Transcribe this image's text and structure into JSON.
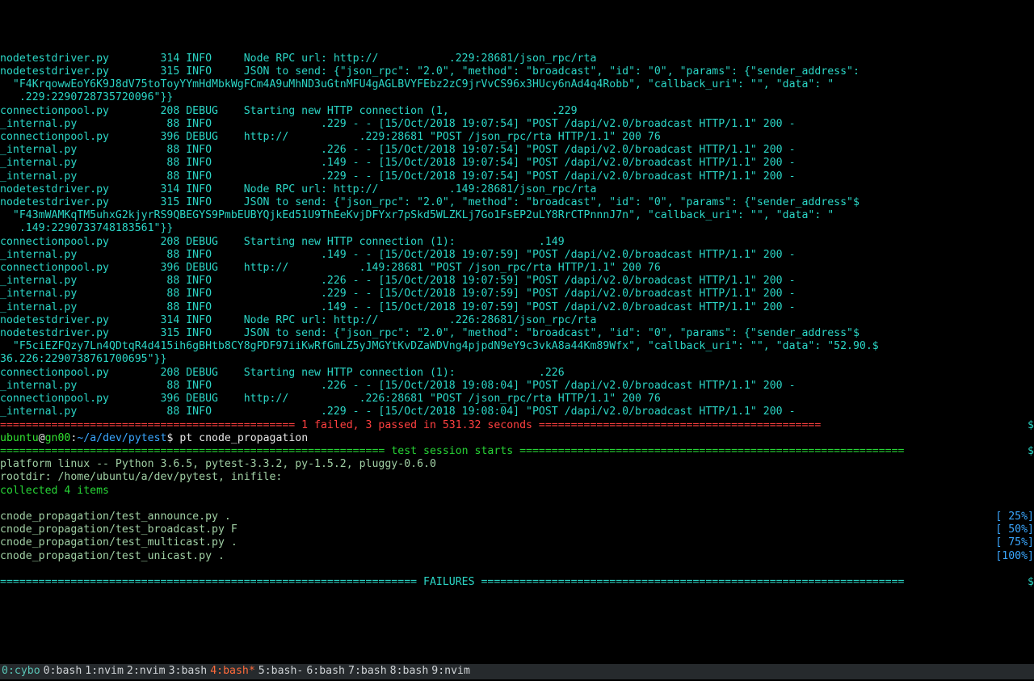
{
  "logs": [
    {
      "file": "nodetestdriver.py",
      "no": "314",
      "lvl": "INFO ",
      "msg": "Node RPC url: http://           .229:28681/json_rpc/rta"
    },
    {
      "file": "nodetestdriver.py",
      "no": "315",
      "lvl": "INFO ",
      "msg": "JSON to send: {\"json_rpc\": \"2.0\", \"method\": \"broadcast\", \"id\": \"0\", \"params\": {\"sender_address\":",
      "cont": [
        "  \"F4KrqowwEoY6K9J8dV75toToyYYmHdMbkWgFCm4A9uMhND3uGtnMFU4gAGLBVYFEbz2zC9jrVvCS96x3HUcy6nAd4q4Robb\", \"callback_uri\": \"\", \"data\": \"  ",
        "   .229:2290728735720096\"}}"
      ]
    },
    {
      "file": "connectionpool.py",
      "no": "208",
      "lvl": "DEBUG",
      "msg": "Starting new HTTP connection (1,                .229"
    },
    {
      "file": "_internal.py",
      "no": " 88",
      "lvl": "INFO ",
      "msg": "            .229 - - [15/Oct/2018 19:07:54] \"POST /dapi/v2.0/broadcast HTTP/1.1\" 200 -"
    },
    {
      "file": "connectionpool.py",
      "no": "396",
      "lvl": "DEBUG",
      "msg": "http://           .229:28681 \"POST /json_rpc/rta HTTP/1.1\" 200 76"
    },
    {
      "file": "_internal.py",
      "no": " 88",
      "lvl": "INFO ",
      "msg": "            .226 - - [15/Oct/2018 19:07:54] \"POST /dapi/v2.0/broadcast HTTP/1.1\" 200 -"
    },
    {
      "file": "_internal.py",
      "no": " 88",
      "lvl": "INFO ",
      "msg": "            .149 - - [15/Oct/2018 19:07:54] \"POST /dapi/v2.0/broadcast HTTP/1.1\" 200 -"
    },
    {
      "file": "_internal.py",
      "no": " 88",
      "lvl": "INFO ",
      "msg": "            .229 - - [15/Oct/2018 19:07:54] \"POST /dapi/v2.0/broadcast HTTP/1.1\" 200 -"
    },
    {
      "file": "nodetestdriver.py",
      "no": "314",
      "lvl": "INFO ",
      "msg": "Node RPC url: http://           .149:28681/json_rpc/rta"
    },
    {
      "file": "nodetestdriver.py",
      "no": "315",
      "lvl": "INFO ",
      "msg": "JSON to send: {\"json_rpc\": \"2.0\", \"method\": \"broadcast\", \"id\": \"0\", \"params\": {\"sender_address\"$",
      "cont": [
        "  \"F43mWAMKqTM5uhxG2kjyrRS9QBEGYS9PmbEUBYQjkEd51U9ThEeKvjDFYxr7pSkd5WLZKLj7Go1FsEP2uLY8RrCTPnnnJ7n\", \"callback_uri\": \"\", \"data\": \"",
        "   .149:2290733748183561\"}}"
      ]
    },
    {
      "file": "connectionpool.py",
      "no": "208",
      "lvl": "DEBUG",
      "msg": "Starting new HTTP connection (1):             .149"
    },
    {
      "file": "_internal.py",
      "no": " 88",
      "lvl": "INFO ",
      "msg": "            .149 - - [15/Oct/2018 19:07:59] \"POST /dapi/v2.0/broadcast HTTP/1.1\" 200 -"
    },
    {
      "file": "connectionpool.py",
      "no": "396",
      "lvl": "DEBUG",
      "msg": "http://           .149:28681 \"POST /json_rpc/rta HTTP/1.1\" 200 76"
    },
    {
      "file": "_internal.py",
      "no": " 88",
      "lvl": "INFO ",
      "msg": "            .226 - - [15/Oct/2018 19:07:59] \"POST /dapi/v2.0/broadcast HTTP/1.1\" 200 -"
    },
    {
      "file": "_internal.py",
      "no": " 88",
      "lvl": "INFO ",
      "msg": "            .229 - - [15/Oct/2018 19:07:59] \"POST /dapi/v2.0/broadcast HTTP/1.1\" 200 -"
    },
    {
      "file": "_internal.py",
      "no": " 88",
      "lvl": "INFO ",
      "msg": "            .149 - - [15/Oct/2018 19:07:59] \"POST /dapi/v2.0/broadcast HTTP/1.1\" 200 -"
    },
    {
      "file": "nodetestdriver.py",
      "no": "314",
      "lvl": "INFO ",
      "msg": "Node RPC url: http://           .226:28681/json_rpc/rta"
    },
    {
      "file": "nodetestdriver.py",
      "no": "315",
      "lvl": "INFO ",
      "msg": "JSON to send: {\"json_rpc\": \"2.0\", \"method\": \"broadcast\", \"id\": \"0\", \"params\": {\"sender_address\"$",
      "cont": [
        "  \"F5ciEZFQzy7Ln4QDtqR4d415ih6gBHtb8CY8gPDF97iiKwRfGmLZ5yJMGYtKvDZaWDVng4pjpdN9eY9c3vkA8a44Km89Wfx\", \"callback_uri\": \"\", \"data\": \"52.90.$",
        "36.226:2290738761700695\"}}"
      ]
    },
    {
      "file": "connectionpool.py",
      "no": "208",
      "lvl": "DEBUG",
      "msg": "Starting new HTTP connection (1):             .226"
    },
    {
      "file": "_internal.py",
      "no": " 88",
      "lvl": "INFO ",
      "msg": "            .226 - - [15/Oct/2018 19:08:04] \"POST /dapi/v2.0/broadcast HTTP/1.1\" 200 -"
    },
    {
      "file": "connectionpool.py",
      "no": "396",
      "lvl": "DEBUG",
      "msg": "http://           .226:28681 \"POST /json_rpc/rta HTTP/1.1\" 200 76"
    },
    {
      "file": "_internal.py",
      "no": " 88",
      "lvl": "INFO ",
      "msg": "            .229 - - [15/Oct/2018 19:08:04] \"POST /dapi/v2.0/broadcast HTTP/1.1\" 200 -"
    }
  ],
  "summary_prev": "============================================== 1 failed, 3 passed in 531.32 seconds ============================================",
  "summary_prev_trail": "$",
  "prompt": {
    "user": "ubuntu",
    "at": "@",
    "host": "gn00",
    "sep": ":",
    "path": "~/a/dev/pytest",
    "dollar": "$ ",
    "cmd": "pt cnode_propagation"
  },
  "session_header": "============================================================ test session starts ============================================================",
  "session_trail": "$",
  "platform": "platform linux -- Python 3.6.5, pytest-3.3.2, py-1.5.2, pluggy-0.6.0",
  "rootdir": "rootdir: /home/ubuntu/a/dev/pytest, inifile:",
  "collected": "collected 4 items",
  "tests": [
    {
      "name": "cnode_propagation/test_announce.py .",
      "pct": "[ 25%]"
    },
    {
      "name": "cnode_propagation/test_broadcast.py F",
      "pct": "[ 50%]"
    },
    {
      "name": "cnode_propagation/test_multicast.py .",
      "pct": "[ 75%]"
    },
    {
      "name": "cnode_propagation/test_unicast.py .",
      "pct": "[100%]"
    }
  ],
  "failures_header": "================================================================= FAILURES ==================================================================",
  "failures_trail": "$",
  "statusbar": {
    "session": "0:cybo",
    "tabs": [
      "0:bash",
      "1:nvim",
      "2:nvim",
      "3:bash",
      "4:bash*",
      "5:bash-",
      "6:bash",
      "7:bash",
      "8:bash",
      "9:nvim"
    ],
    "active_index": 4
  }
}
